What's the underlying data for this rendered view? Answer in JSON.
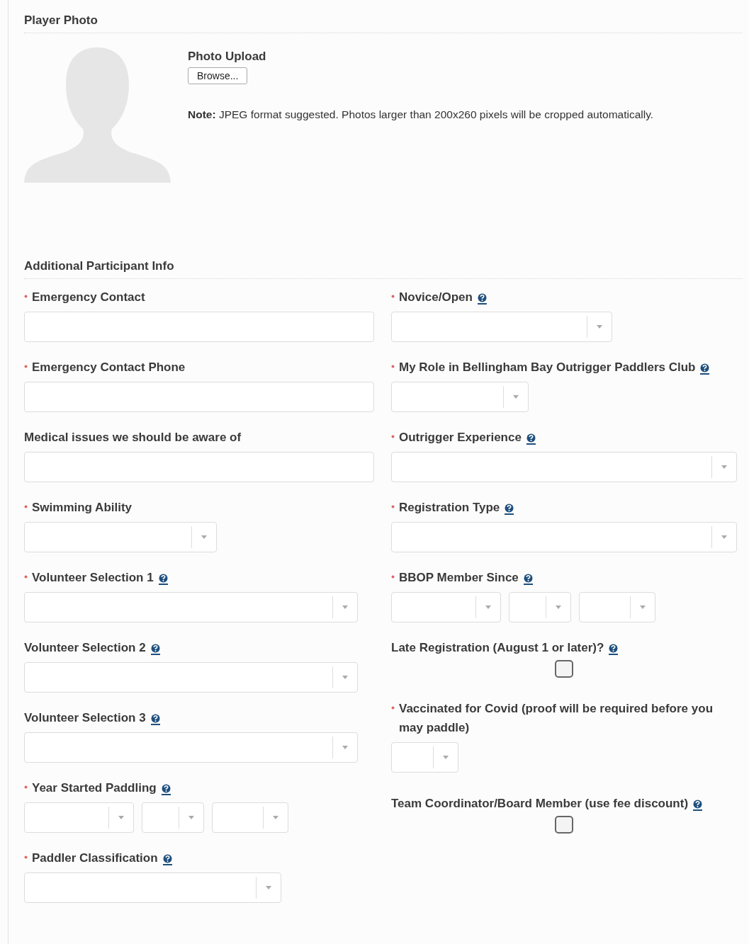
{
  "photo_section": {
    "heading": "Player Photo",
    "upload_label": "Photo Upload",
    "browse_button": "Browse...",
    "note": "**Note:** JPEG format suggested. Photos larger than 200x260 pixels will be cropped automatically."
  },
  "info_section": {
    "heading": "Additional Participant Info",
    "left_fields": [
      {
        "kind": "text",
        "label": "Emergency Contact",
        "required": true,
        "help": false
      },
      {
        "kind": "text",
        "label": "Emergency Contact Phone",
        "required": true,
        "help": false
      },
      {
        "kind": "text",
        "label": "Medical issues we should be aware of",
        "required": false,
        "help": false
      },
      {
        "kind": "select",
        "label": "Swimming Ability",
        "required": true,
        "help": false
      },
      {
        "kind": "select",
        "label": "Volunteer Selection 1",
        "required": true,
        "help": true
      },
      {
        "kind": "select",
        "label": "Volunteer Selection 2",
        "required": false,
        "help": true
      },
      {
        "kind": "select",
        "label": "Volunteer Selection 3",
        "required": false,
        "help": true
      },
      {
        "kind": "date",
        "label": "Year Started Paddling",
        "required": true,
        "help": true
      },
      {
        "kind": "select",
        "label": "Paddler Classification",
        "required": true,
        "help": true
      }
    ],
    "right_fields": [
      {
        "kind": "select",
        "label": "Novice/Open",
        "required": true,
        "help": true
      },
      {
        "kind": "select",
        "label": "My Role in Bellingham Bay Outrigger Paddlers Club",
        "required": true,
        "help": true
      },
      {
        "kind": "select",
        "label": "Outrigger Experience",
        "required": true,
        "help": true
      },
      {
        "kind": "select",
        "label": "Registration Type",
        "required": true,
        "help": true
      },
      {
        "kind": "date",
        "label": "BBOP Member Since",
        "required": true,
        "help": true
      },
      {
        "kind": "checkbox",
        "label": "Late Registration (August 1 or later)?",
        "required": false,
        "help": true,
        "checked": false
      },
      {
        "kind": "select",
        "label": "Vaccinated for Covid (proof will be required before you may paddle)",
        "required": true,
        "help": false
      },
      {
        "kind": "checkbox",
        "label": "Team Coordinator/Board Member (use fee discount)",
        "required": false,
        "help": true,
        "checked": false
      }
    ]
  }
}
